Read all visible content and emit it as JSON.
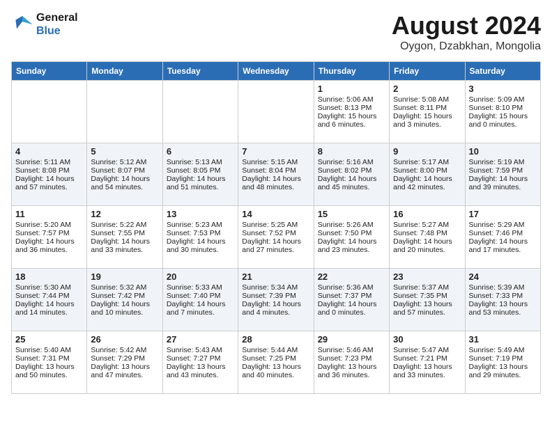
{
  "logo": {
    "line1": "General",
    "line2": "Blue"
  },
  "title": "August 2024",
  "subtitle": "Oygon, Dzabkhan, Mongolia",
  "headers": [
    "Sunday",
    "Monday",
    "Tuesday",
    "Wednesday",
    "Thursday",
    "Friday",
    "Saturday"
  ],
  "weeks": [
    [
      {
        "day": "",
        "text": ""
      },
      {
        "day": "",
        "text": ""
      },
      {
        "day": "",
        "text": ""
      },
      {
        "day": "",
        "text": ""
      },
      {
        "day": "1",
        "text": "Sunrise: 5:06 AM\nSunset: 8:13 PM\nDaylight: 15 hours\nand 6 minutes."
      },
      {
        "day": "2",
        "text": "Sunrise: 5:08 AM\nSunset: 8:11 PM\nDaylight: 15 hours\nand 3 minutes."
      },
      {
        "day": "3",
        "text": "Sunrise: 5:09 AM\nSunset: 8:10 PM\nDaylight: 15 hours\nand 0 minutes."
      }
    ],
    [
      {
        "day": "4",
        "text": "Sunrise: 5:11 AM\nSunset: 8:08 PM\nDaylight: 14 hours\nand 57 minutes."
      },
      {
        "day": "5",
        "text": "Sunrise: 5:12 AM\nSunset: 8:07 PM\nDaylight: 14 hours\nand 54 minutes."
      },
      {
        "day": "6",
        "text": "Sunrise: 5:13 AM\nSunset: 8:05 PM\nDaylight: 14 hours\nand 51 minutes."
      },
      {
        "day": "7",
        "text": "Sunrise: 5:15 AM\nSunset: 8:04 PM\nDaylight: 14 hours\nand 48 minutes."
      },
      {
        "day": "8",
        "text": "Sunrise: 5:16 AM\nSunset: 8:02 PM\nDaylight: 14 hours\nand 45 minutes."
      },
      {
        "day": "9",
        "text": "Sunrise: 5:17 AM\nSunset: 8:00 PM\nDaylight: 14 hours\nand 42 minutes."
      },
      {
        "day": "10",
        "text": "Sunrise: 5:19 AM\nSunset: 7:59 PM\nDaylight: 14 hours\nand 39 minutes."
      }
    ],
    [
      {
        "day": "11",
        "text": "Sunrise: 5:20 AM\nSunset: 7:57 PM\nDaylight: 14 hours\nand 36 minutes."
      },
      {
        "day": "12",
        "text": "Sunrise: 5:22 AM\nSunset: 7:55 PM\nDaylight: 14 hours\nand 33 minutes."
      },
      {
        "day": "13",
        "text": "Sunrise: 5:23 AM\nSunset: 7:53 PM\nDaylight: 14 hours\nand 30 minutes."
      },
      {
        "day": "14",
        "text": "Sunrise: 5:25 AM\nSunset: 7:52 PM\nDaylight: 14 hours\nand 27 minutes."
      },
      {
        "day": "15",
        "text": "Sunrise: 5:26 AM\nSunset: 7:50 PM\nDaylight: 14 hours\nand 23 minutes."
      },
      {
        "day": "16",
        "text": "Sunrise: 5:27 AM\nSunset: 7:48 PM\nDaylight: 14 hours\nand 20 minutes."
      },
      {
        "day": "17",
        "text": "Sunrise: 5:29 AM\nSunset: 7:46 PM\nDaylight: 14 hours\nand 17 minutes."
      }
    ],
    [
      {
        "day": "18",
        "text": "Sunrise: 5:30 AM\nSunset: 7:44 PM\nDaylight: 14 hours\nand 14 minutes."
      },
      {
        "day": "19",
        "text": "Sunrise: 5:32 AM\nSunset: 7:42 PM\nDaylight: 14 hours\nand 10 minutes."
      },
      {
        "day": "20",
        "text": "Sunrise: 5:33 AM\nSunset: 7:40 PM\nDaylight: 14 hours\nand 7 minutes."
      },
      {
        "day": "21",
        "text": "Sunrise: 5:34 AM\nSunset: 7:39 PM\nDaylight: 14 hours\nand 4 minutes."
      },
      {
        "day": "22",
        "text": "Sunrise: 5:36 AM\nSunset: 7:37 PM\nDaylight: 14 hours\nand 0 minutes."
      },
      {
        "day": "23",
        "text": "Sunrise: 5:37 AM\nSunset: 7:35 PM\nDaylight: 13 hours\nand 57 minutes."
      },
      {
        "day": "24",
        "text": "Sunrise: 5:39 AM\nSunset: 7:33 PM\nDaylight: 13 hours\nand 53 minutes."
      }
    ],
    [
      {
        "day": "25",
        "text": "Sunrise: 5:40 AM\nSunset: 7:31 PM\nDaylight: 13 hours\nand 50 minutes."
      },
      {
        "day": "26",
        "text": "Sunrise: 5:42 AM\nSunset: 7:29 PM\nDaylight: 13 hours\nand 47 minutes."
      },
      {
        "day": "27",
        "text": "Sunrise: 5:43 AM\nSunset: 7:27 PM\nDaylight: 13 hours\nand 43 minutes."
      },
      {
        "day": "28",
        "text": "Sunrise: 5:44 AM\nSunset: 7:25 PM\nDaylight: 13 hours\nand 40 minutes."
      },
      {
        "day": "29",
        "text": "Sunrise: 5:46 AM\nSunset: 7:23 PM\nDaylight: 13 hours\nand 36 minutes."
      },
      {
        "day": "30",
        "text": "Sunrise: 5:47 AM\nSunset: 7:21 PM\nDaylight: 13 hours\nand 33 minutes."
      },
      {
        "day": "31",
        "text": "Sunrise: 5:49 AM\nSunset: 7:19 PM\nDaylight: 13 hours\nand 29 minutes."
      }
    ]
  ]
}
